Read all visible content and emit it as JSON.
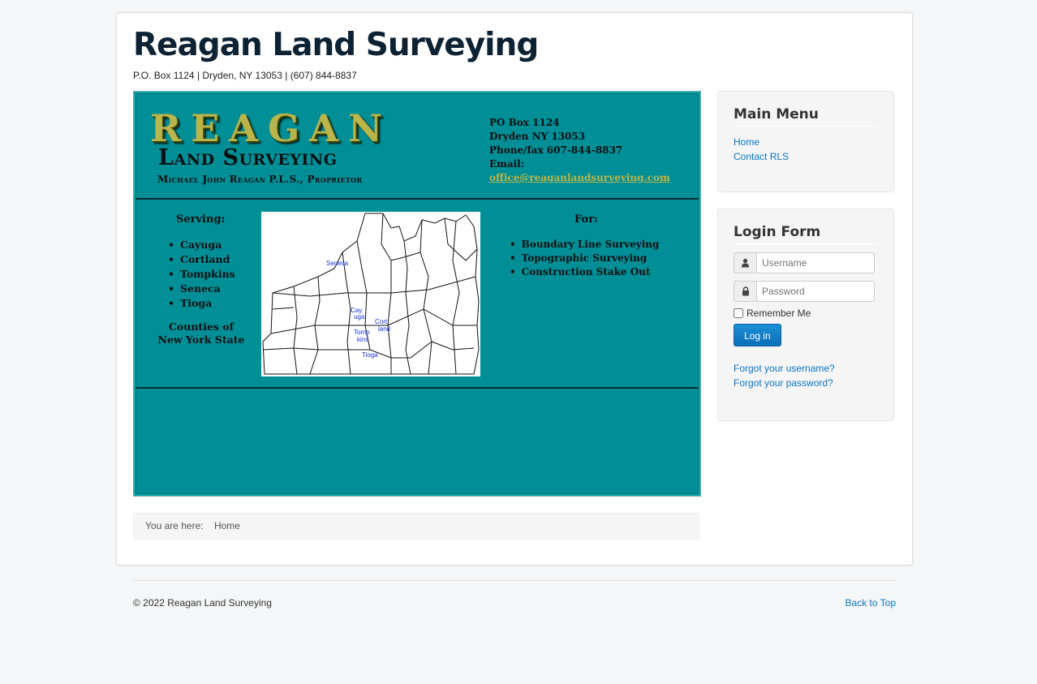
{
  "site": {
    "title": "Reagan Land Surveying",
    "description": "P.O. Box 1124 | Dryden, NY 13053 | (607) 844-8837"
  },
  "banner": {
    "logo_main": "REAGAN",
    "logo_sub": "Land Surveying",
    "owner": "Michael John Reagan P.L.S., Proprietor",
    "contact": {
      "line1": "PO Box 1124",
      "line2": "Dryden NY 13053",
      "line3": "Phone/fax 607-844-8837",
      "email_label": "Email:",
      "email": "office@reaganlandsurveying.com"
    },
    "serving_title": "Serving:",
    "counties": [
      "Cayuga",
      "Cortland",
      "Tompkins",
      "Seneca",
      "Tioga"
    ],
    "counties_caption_1": "Counties of",
    "counties_caption_2": "New York State",
    "for_title": "For:",
    "services": [
      "Boundary Line Surveying",
      "Topographic Surveying",
      "Construction Stake Out"
    ],
    "map_labels": {
      "seneca": "Seneca",
      "cayuga_1": "Cay",
      "cayuga_2": "uga",
      "cortland_1": "Cort",
      "cortland_2": "land",
      "tompkins_1": "Tomp",
      "tompkins_2": "kins",
      "tioga": "Tioga"
    },
    "colors": {
      "background": "#008f96",
      "gold": "#b9b54a"
    }
  },
  "breadcrumb": {
    "label": "You are here:",
    "current": "Home"
  },
  "main_menu": {
    "title": "Main Menu",
    "items": [
      "Home",
      "Contact RLS"
    ]
  },
  "login": {
    "title": "Login Form",
    "username_placeholder": "Username",
    "password_placeholder": "Password",
    "remember_label": "Remember Me",
    "button_label": "Log in",
    "forgot_username": "Forgot your username?",
    "forgot_password": "Forgot your password?"
  },
  "footer": {
    "copyright": "© 2022 Reagan Land Surveying",
    "back_to_top": "Back to Top"
  },
  "icons": {
    "username": "user-icon",
    "password": "lock-icon"
  },
  "colors": {
    "link": "#0a76c6",
    "heading": "#0d2233",
    "button": "#1b8fd8"
  }
}
